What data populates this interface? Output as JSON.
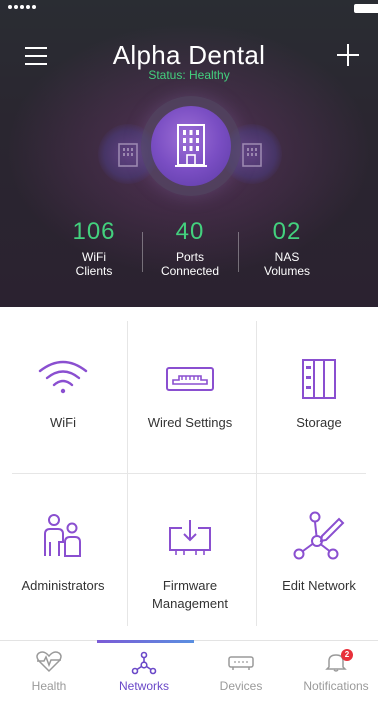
{
  "header": {
    "title": "Alpha Dental",
    "status": "Status: Healthy",
    "menu_icon": "hamburger-menu-icon",
    "add_icon": "plus-icon",
    "center_icon": "building-icon"
  },
  "stats": [
    {
      "value": "106",
      "label_line1": "WiFi",
      "label_line2": "Clients"
    },
    {
      "value": "40",
      "label_line1": "Ports",
      "label_line2": "Connected"
    },
    {
      "value": "02",
      "label_line1": "NAS",
      "label_line2": "Volumes"
    }
  ],
  "tiles": [
    {
      "label": "WiFi",
      "icon": "wifi-icon"
    },
    {
      "label": "Wired Settings",
      "icon": "ethernet-port-icon"
    },
    {
      "label": "Storage",
      "icon": "storage-icon"
    },
    {
      "label": "Administrators",
      "icon": "administrators-icon"
    },
    {
      "label_line1": "Firmware",
      "label_line2": "Management",
      "icon": "firmware-download-icon"
    },
    {
      "label": "Edit Network",
      "icon": "edit-network-icon"
    }
  ],
  "tabs": [
    {
      "label": "Health",
      "icon": "heartbeat-icon"
    },
    {
      "label": "Networks",
      "icon": "network-topology-icon",
      "active": true
    },
    {
      "label": "Devices",
      "icon": "device-icon"
    },
    {
      "label": "Notifications",
      "icon": "bell-icon",
      "badge": "2"
    }
  ],
  "colors": {
    "accent_green": "#43d17e",
    "accent_purple": "#7b5bd6",
    "tab_active": "#6a48c8",
    "badge_red": "#e8303a"
  }
}
